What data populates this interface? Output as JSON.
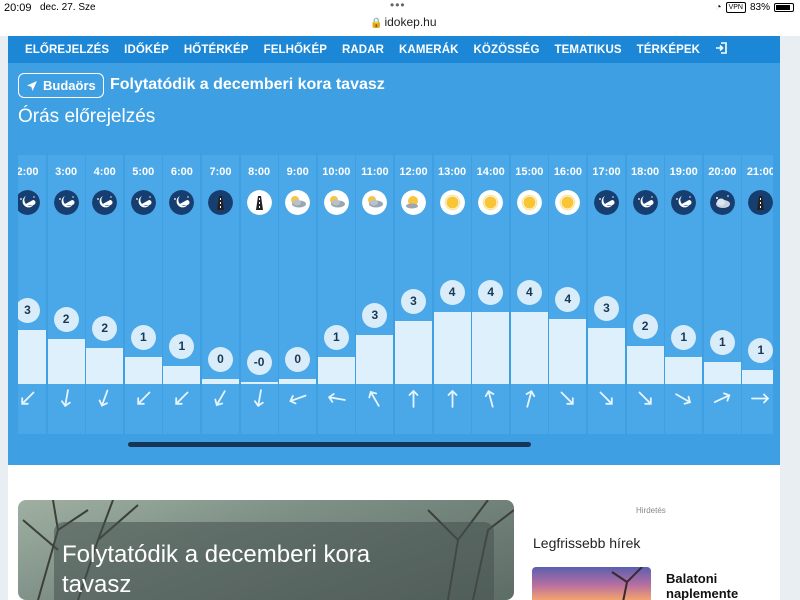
{
  "status_bar": {
    "time": "20:09",
    "date": "dec. 27. Sze",
    "url": "idokep.hu",
    "vpn_label": "VPN",
    "battery": "83%"
  },
  "nav": {
    "items": [
      "ELŐREJELZÉS",
      "IDŐKÉP",
      "HŐTÉRKÉP",
      "FELHŐKÉP",
      "RADAR",
      "KAMERÁK",
      "KÖZÖSSÉG",
      "TEMATIKUS",
      "TÉRKÉPEK"
    ],
    "login_icon": "login-icon"
  },
  "forecast": {
    "location": "Budaörs",
    "headline": "Folytatódik a decemberi kora tavasz",
    "section_title": "Órás előrejelzés",
    "temp_scale": {
      "min": 0,
      "max": 4
    },
    "hours": [
      {
        "time": "2:00",
        "icon": "night-clear",
        "temp": "3",
        "value": 3,
        "wind_deg": 225
      },
      {
        "time": "3:00",
        "icon": "night-clear",
        "temp": "2",
        "value": 2.5,
        "wind_deg": 190
      },
      {
        "time": "4:00",
        "icon": "night-clear",
        "temp": "2",
        "value": 2,
        "wind_deg": 200
      },
      {
        "time": "5:00",
        "icon": "night-clear",
        "temp": "1",
        "value": 1.5,
        "wind_deg": 225
      },
      {
        "time": "6:00",
        "icon": "night-clear",
        "temp": "1",
        "value": 1,
        "wind_deg": 225
      },
      {
        "time": "7:00",
        "icon": "road-night",
        "temp": "0",
        "value": 0.3,
        "wind_deg": 210
      },
      {
        "time": "8:00",
        "icon": "road-day",
        "temp": "-0",
        "value": 0.1,
        "wind_deg": 190
      },
      {
        "time": "9:00",
        "icon": "day-cloudy",
        "temp": "0",
        "value": 0.3,
        "wind_deg": 250
      },
      {
        "time": "10:00",
        "icon": "day-cloudy",
        "temp": "1",
        "value": 1.5,
        "wind_deg": 280
      },
      {
        "time": "11:00",
        "icon": "day-cloudy",
        "temp": "3",
        "value": 2.7,
        "wind_deg": 330
      },
      {
        "time": "12:00",
        "icon": "day-partly",
        "temp": "3",
        "value": 3.5,
        "wind_deg": 0
      },
      {
        "time": "13:00",
        "icon": "day-sunny",
        "temp": "4",
        "value": 4,
        "wind_deg": 0
      },
      {
        "time": "14:00",
        "icon": "day-sunny",
        "temp": "4",
        "value": 4,
        "wind_deg": 345
      },
      {
        "time": "15:00",
        "icon": "day-sunny",
        "temp": "4",
        "value": 4,
        "wind_deg": 15
      },
      {
        "time": "16:00",
        "icon": "day-sunny",
        "temp": "4",
        "value": 3.6,
        "wind_deg": 135
      },
      {
        "time": "17:00",
        "icon": "night-clear",
        "temp": "3",
        "value": 3.1,
        "wind_deg": 135
      },
      {
        "time": "18:00",
        "icon": "night-clear",
        "temp": "2",
        "value": 2.1,
        "wind_deg": 135
      },
      {
        "time": "19:00",
        "icon": "night-clear",
        "temp": "1",
        "value": 1.5,
        "wind_deg": 120
      },
      {
        "time": "20:00",
        "icon": "night-cloudy",
        "temp": "1",
        "value": 1.2,
        "wind_deg": 65
      },
      {
        "time": "21:00",
        "icon": "road-night",
        "temp": "1",
        "value": 0.8,
        "wind_deg": 90
      }
    ]
  },
  "article": {
    "title": "Folytatódik a decemberi kora tavasz"
  },
  "sidebar": {
    "ad_label": "Hirdetés",
    "news_heading": "Legfrissebb hírek",
    "news_title": "Balatoni naplemente"
  },
  "colors": {
    "nav_bg": "#1c87d6",
    "panel_bg": "#3e9fe3",
    "column_bg": "#4aa7e8",
    "bar_fill": "#def0fb",
    "night_icon_bg": "#173e70",
    "scrollbar": "#173556"
  }
}
